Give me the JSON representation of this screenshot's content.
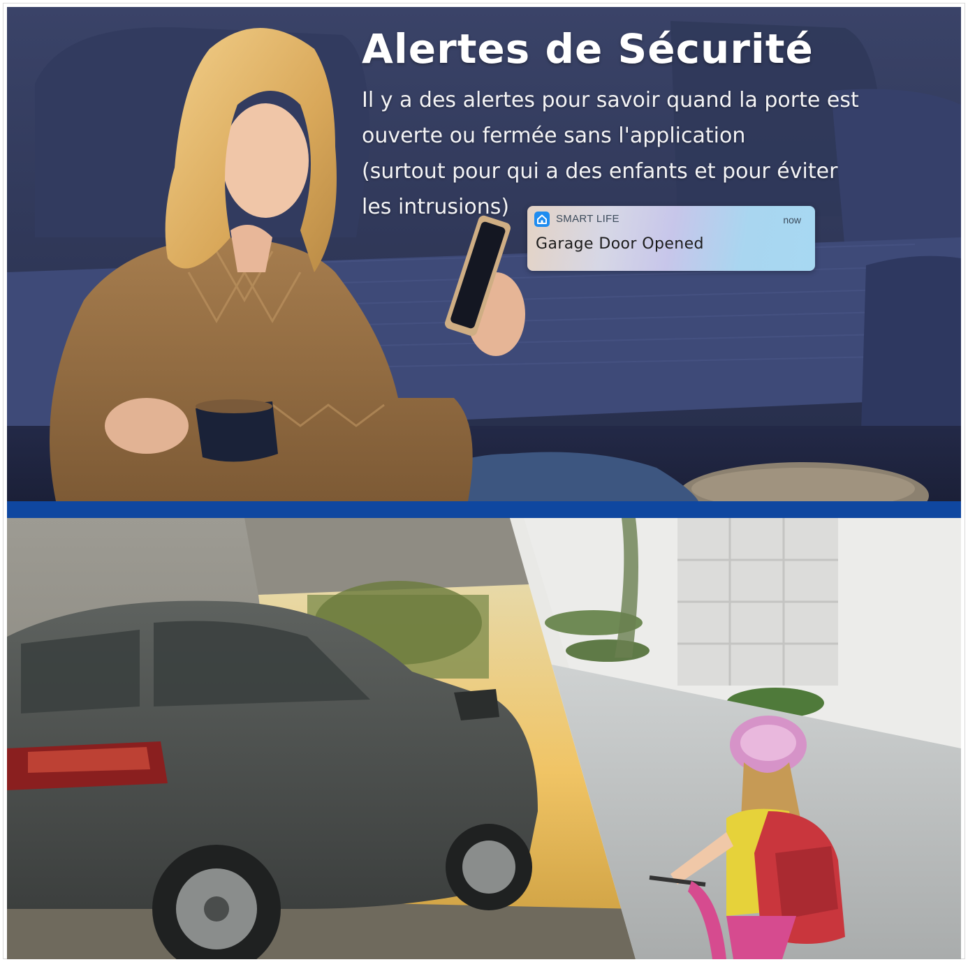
{
  "headline": "Alertes de Sécurité",
  "description_lines": [
    "Il y a des alertes pour savoir quand la porte est",
    "ouverte ou fermée sans l'application",
    "(surtout pour qui a des enfants et pour éviter",
    "les intrusions)"
  ],
  "notification": {
    "app_name": "SMART LIFE",
    "time": "now",
    "message": "Garage Door Opened",
    "icon": "home-icon"
  },
  "colors": {
    "divider": "#0f47a0",
    "app_icon": "#1e8cf0"
  }
}
